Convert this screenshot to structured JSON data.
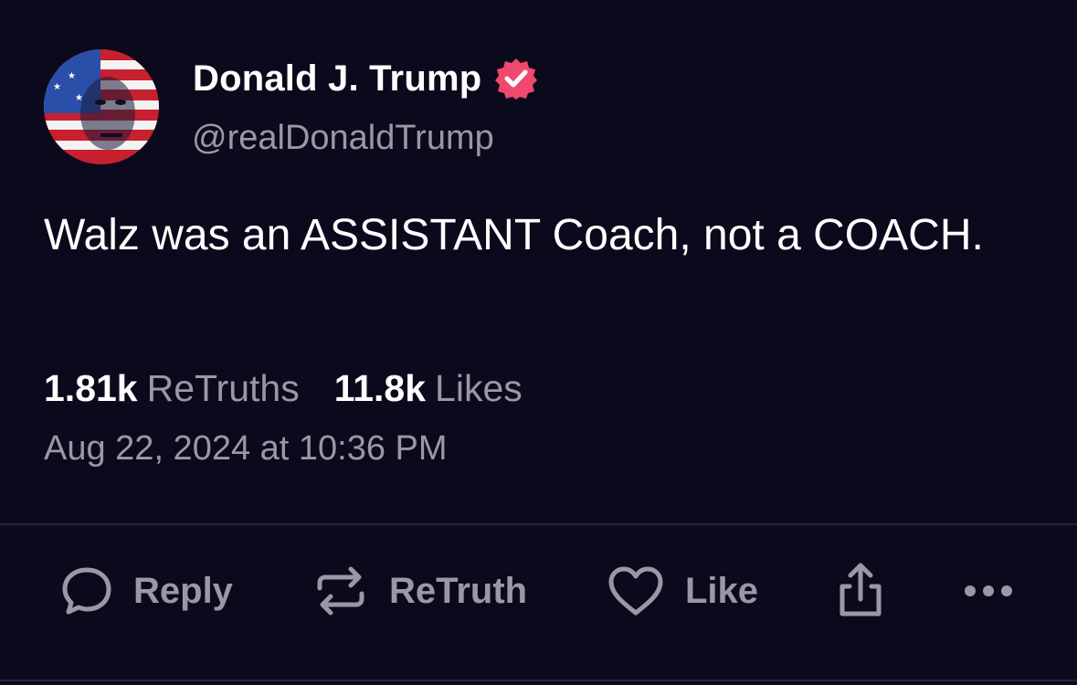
{
  "author": {
    "display_name": "Donald J. Trump",
    "handle": "@realDonaldTrump",
    "avatar_icon": "flag-portrait-avatar",
    "verified_icon": "verified-badge-icon",
    "verified_color": "#f0486e"
  },
  "post": {
    "text": "Walz was an ASSISTANT Coach, not a COACH."
  },
  "stats": {
    "retruths_count": "1.81k",
    "retruths_label": "ReTruths",
    "likes_count": "11.8k",
    "likes_label": "Likes"
  },
  "timestamp": "Aug 22, 2024 at 10:36 PM",
  "actions": {
    "reply_label": "Reply",
    "retruth_label": "ReTruth",
    "like_label": "Like",
    "share_icon": "share-icon",
    "more_icon": "more-icon"
  },
  "colors": {
    "background": "#0b0a1c",
    "muted_text": "#9a98a6",
    "primary_text": "#ffffff"
  }
}
